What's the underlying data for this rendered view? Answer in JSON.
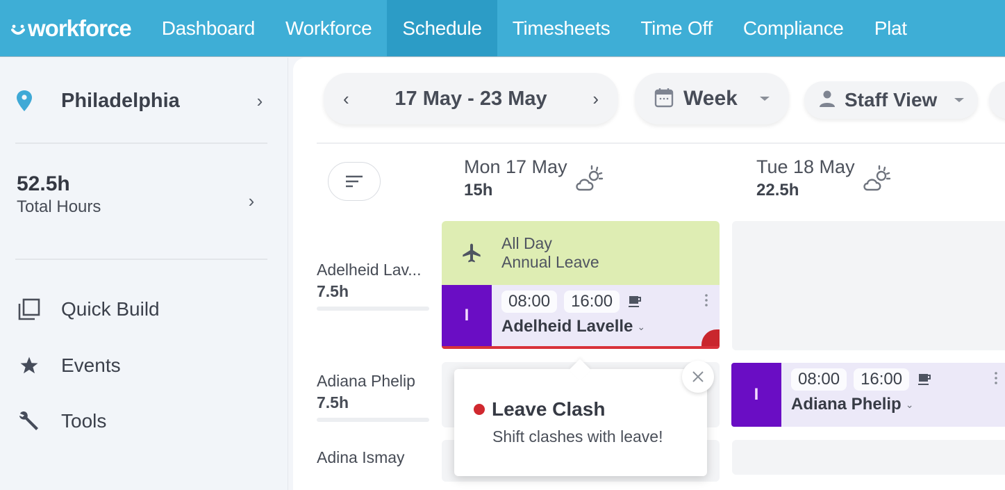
{
  "app": {
    "logo_text": "workforce",
    "brand_color": "#3eaed6",
    "active_nav_color": "#2c9cc6"
  },
  "nav": {
    "items": [
      {
        "label": "Dashboard",
        "active": false
      },
      {
        "label": "Workforce",
        "active": false
      },
      {
        "label": "Schedule",
        "active": true
      },
      {
        "label": "Timesheets",
        "active": false
      },
      {
        "label": "Time Off",
        "active": false
      },
      {
        "label": "Compliance",
        "active": false
      },
      {
        "label": "Plat",
        "active": false
      }
    ]
  },
  "sidebar": {
    "location": {
      "label": "Philadelphia",
      "icon": "map-pin-icon"
    },
    "total_hours": {
      "value": "52.5h",
      "label": "Total Hours"
    },
    "menu": [
      {
        "label": "Quick Build",
        "icon": "copy-stack-icon"
      },
      {
        "label": "Events",
        "icon": "star-icon"
      },
      {
        "label": "Tools",
        "icon": "wrench-icon"
      }
    ]
  },
  "toolbar": {
    "date_range": "17 May - 23 May",
    "prev_label": "‹",
    "next_label": "›",
    "period": "Week",
    "view": "Staff View"
  },
  "days": [
    {
      "label": "Mon 17 May",
      "hours": "15h",
      "weather": "partly-cloudy-icon"
    },
    {
      "label": "Tue 18 May",
      "hours": "22.5h",
      "weather": "partly-cloudy-icon"
    }
  ],
  "staff": [
    {
      "name": "Adelheid Lav...",
      "hours": "7.5h"
    },
    {
      "name": "Adiana Phelip",
      "hours": "7.5h"
    },
    {
      "name": "Adina Ismay",
      "hours": ""
    }
  ],
  "leave": {
    "when": "All Day",
    "type": "Annual Leave",
    "color": "#deedb3"
  },
  "shifts": [
    {
      "role_initial": "I",
      "start": "08:00",
      "end": "16:00",
      "employee": "Adelheid Lavelle",
      "day": "Mon 17 May",
      "clash": true,
      "role_color": "#6a0dc4"
    },
    {
      "role_initial": "I",
      "start": "08:00",
      "end": "16:00",
      "employee": "Adiana Phelip",
      "day": "Tue 18 May",
      "clash": false,
      "role_color": "#6a0dc4"
    }
  ],
  "popover": {
    "title": "Leave Clash",
    "message": "Shift clashes with leave!",
    "status_color": "#d0282f"
  }
}
